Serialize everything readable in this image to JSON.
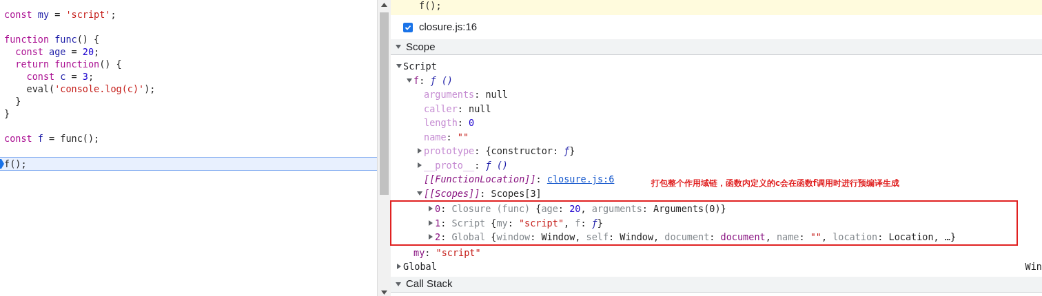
{
  "editor": {
    "lines": [
      {
        "current": false,
        "tokens": [
          {
            "text": "const",
            "kind": "keyword"
          },
          {
            "text": " my",
            "kind": "variable"
          },
          {
            "text": " = ",
            "kind": "plain"
          },
          {
            "text": "'script'",
            "kind": "string"
          },
          {
            "text": ";",
            "kind": "plain"
          }
        ]
      },
      {
        "current": false
      },
      {
        "current": false,
        "tokens": [
          {
            "text": "function",
            "kind": "keyword"
          },
          {
            "text": " func",
            "kind": "variable"
          },
          {
            "text": "() {",
            "kind": "plain"
          }
        ]
      },
      {
        "current": false,
        "tokens": [
          {
            "text": "  const",
            "kind": "keyword"
          },
          {
            "text": " age",
            "kind": "variable"
          },
          {
            "text": " = ",
            "kind": "plain"
          },
          {
            "text": "20",
            "kind": "number"
          },
          {
            "text": ";",
            "kind": "plain"
          }
        ]
      },
      {
        "current": false,
        "tokens": [
          {
            "text": "  return function",
            "kind": "keyword"
          },
          {
            "text": "() {",
            "kind": "plain"
          }
        ]
      },
      {
        "current": false,
        "tokens": [
          {
            "text": "    const",
            "kind": "keyword"
          },
          {
            "text": " c",
            "kind": "variable"
          },
          {
            "text": " = ",
            "kind": "plain"
          },
          {
            "text": "3",
            "kind": "number"
          },
          {
            "text": ";",
            "kind": "plain"
          }
        ]
      },
      {
        "current": false,
        "tokens": [
          {
            "text": "    eval(",
            "kind": "plain"
          },
          {
            "text": "'console.log(c)'",
            "kind": "string"
          },
          {
            "text": ");",
            "kind": "plain"
          }
        ]
      },
      {
        "current": false,
        "tokens": [
          {
            "text": "  }",
            "kind": "plain"
          }
        ]
      },
      {
        "current": false,
        "tokens": [
          {
            "text": "}",
            "kind": "plain"
          }
        ]
      },
      {
        "current": false
      },
      {
        "current": false,
        "tokens": [
          {
            "text": "const",
            "kind": "keyword"
          },
          {
            "text": " f",
            "kind": "variable"
          },
          {
            "text": " = func();",
            "kind": "plain"
          }
        ]
      },
      {
        "current": false
      },
      {
        "current": true,
        "tokens": [
          {
            "text": "f();",
            "kind": "plain"
          }
        ]
      }
    ]
  },
  "paused_line": "f();",
  "breakpoint": {
    "label": "closure.js:16",
    "checked": true
  },
  "scope": {
    "title": "Scope",
    "expanded": true,
    "tree": [
      {
        "key": "Script",
        "kind": "scope",
        "expanded": true,
        "children": [
          {
            "key": "f",
            "kind": "own",
            "expanded": true,
            "value": [
              {
                "text": ": ",
                "kind": "plain"
              },
              {
                "text": "ƒ ()",
                "kind": "function"
              }
            ],
            "children": [
              {
                "key": "arguments",
                "kind": "inherited",
                "value": [
                  {
                    "text": ": null",
                    "kind": "plain"
                  }
                ]
              },
              {
                "key": "caller",
                "kind": "inherited",
                "value": [
                  {
                    "text": ": null",
                    "kind": "plain"
                  }
                ]
              },
              {
                "key": "length",
                "kind": "inherited",
                "value": [
                  {
                    "text": ": ",
                    "kind": "plain"
                  },
                  {
                    "text": "0",
                    "kind": "number"
                  }
                ]
              },
              {
                "key": "name",
                "kind": "inherited",
                "value": [
                  {
                    "text": ": ",
                    "kind": "plain"
                  },
                  {
                    "text": "\"\"",
                    "kind": "string"
                  }
                ]
              },
              {
                "key": "prototype",
                "kind": "inherited",
                "expanded": false,
                "value": [
                  {
                    "text": ": {constructor: ",
                    "kind": "plain"
                  },
                  {
                    "text": "ƒ",
                    "kind": "function"
                  },
                  {
                    "text": "}",
                    "kind": "plain"
                  }
                ]
              },
              {
                "key": "__proto__",
                "kind": "inherited",
                "expanded": false,
                "value": [
                  {
                    "text": ": ",
                    "kind": "plain"
                  },
                  {
                    "text": "ƒ ()",
                    "kind": "function"
                  }
                ]
              },
              {
                "key": "[[FunctionLocation]]",
                "kind": "internal",
                "value": [
                  {
                    "text": ": ",
                    "kind": "plain"
                  },
                  {
                    "text": "closure.js:6",
                    "kind": "link"
                  }
                ]
              },
              {
                "key": "[[Scopes]]",
                "kind": "internal",
                "expanded": true,
                "outlined": true,
                "value": [
                  {
                    "text": ": Scopes[3]",
                    "kind": "plain"
                  }
                ],
                "children": [
                  {
                    "key": "0",
                    "kind": "own",
                    "expanded": false,
                    "value": [
                      {
                        "text": ": ",
                        "kind": "plain"
                      },
                      {
                        "text": "Closure (func)",
                        "kind": "gray"
                      },
                      {
                        "text": " {",
                        "kind": "plain"
                      },
                      {
                        "text": "age",
                        "kind": "gray"
                      },
                      {
                        "text": ": ",
                        "kind": "plain"
                      },
                      {
                        "text": "20",
                        "kind": "number"
                      },
                      {
                        "text": ", ",
                        "kind": "plain"
                      },
                      {
                        "text": "arguments",
                        "kind": "gray"
                      },
                      {
                        "text": ": Arguments(0)}",
                        "kind": "plain"
                      }
                    ]
                  },
                  {
                    "key": "1",
                    "kind": "own",
                    "expanded": false,
                    "value": [
                      {
                        "text": ": ",
                        "kind": "plain"
                      },
                      {
                        "text": "Script",
                        "kind": "gray"
                      },
                      {
                        "text": " {",
                        "kind": "plain"
                      },
                      {
                        "text": "my",
                        "kind": "gray"
                      },
                      {
                        "text": ": ",
                        "kind": "plain"
                      },
                      {
                        "text": "\"script\"",
                        "kind": "string"
                      },
                      {
                        "text": ", ",
                        "kind": "plain"
                      },
                      {
                        "text": "f",
                        "kind": "gray"
                      },
                      {
                        "text": ": ",
                        "kind": "plain"
                      },
                      {
                        "text": "ƒ",
                        "kind": "function"
                      },
                      {
                        "text": "}",
                        "kind": "plain"
                      }
                    ]
                  },
                  {
                    "key": "2",
                    "kind": "own",
                    "expanded": false,
                    "value": [
                      {
                        "text": ": ",
                        "kind": "plain"
                      },
                      {
                        "text": "Global",
                        "kind": "gray"
                      },
                      {
                        "text": " {",
                        "kind": "plain"
                      },
                      {
                        "text": "window",
                        "kind": "gray"
                      },
                      {
                        "text": ": Window, ",
                        "kind": "plain"
                      },
                      {
                        "text": "self",
                        "kind": "gray"
                      },
                      {
                        "text": ": Window, ",
                        "kind": "plain"
                      },
                      {
                        "text": "document",
                        "kind": "gray"
                      },
                      {
                        "text": ": ",
                        "kind": "plain"
                      },
                      {
                        "text": "document",
                        "kind": "object"
                      },
                      {
                        "text": ", ",
                        "kind": "plain"
                      },
                      {
                        "text": "name",
                        "kind": "gray"
                      },
                      {
                        "text": ": ",
                        "kind": "plain"
                      },
                      {
                        "text": "\"\"",
                        "kind": "string"
                      },
                      {
                        "text": ", ",
                        "kind": "plain"
                      },
                      {
                        "text": "location",
                        "kind": "gray"
                      },
                      {
                        "text": ": Location, …}",
                        "kind": "plain"
                      }
                    ]
                  }
                ]
              }
            ]
          },
          {
            "key": "my",
            "kind": "own",
            "value": [
              {
                "text": ": ",
                "kind": "plain"
              },
              {
                "text": "\"script\"",
                "kind": "string"
              }
            ]
          }
        ]
      },
      {
        "key": "Global",
        "kind": "scope",
        "expanded": false,
        "value": [
          {
            "text": "Win",
            "kind": "plain"
          }
        ]
      }
    ]
  },
  "annotation": "打包整个作用域链，函数内定义的c会在函数f调用时进行预编译生成",
  "call_stack": {
    "title": "Call Stack",
    "expanded": true
  }
}
